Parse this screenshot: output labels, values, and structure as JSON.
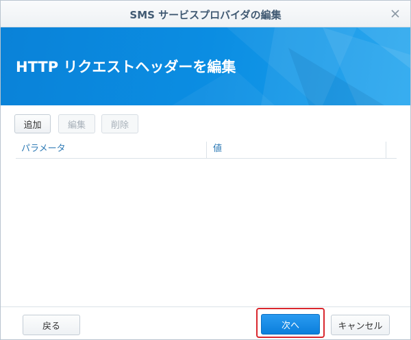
{
  "window": {
    "title": "SMS サービスプロバイダの編集",
    "close_icon": "close-icon"
  },
  "banner": {
    "title": "HTTP リクエストヘッダーを編集",
    "color": "#0b8de2"
  },
  "toolbar": {
    "add_label": "追加",
    "edit_label": "編集",
    "delete_label": "削除"
  },
  "grid": {
    "columns": [
      "パラメータ",
      "値"
    ],
    "rows": []
  },
  "footer": {
    "back_label": "戻る",
    "next_label": "次へ",
    "cancel_label": "キャンセル"
  },
  "colors": {
    "accent": "#0b7fdc",
    "highlight": "#d9262c",
    "header_text": "#2e7ab5"
  }
}
